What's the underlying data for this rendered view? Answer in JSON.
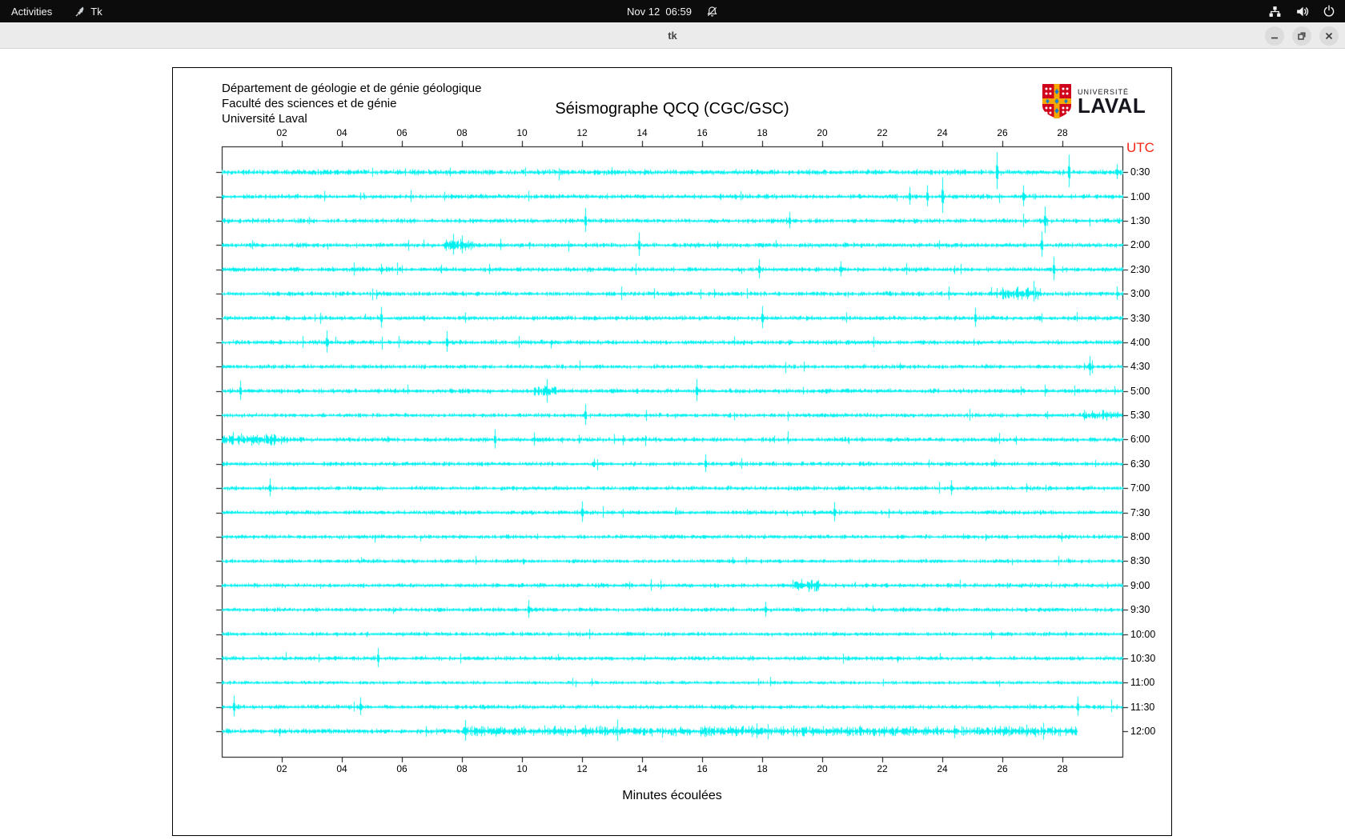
{
  "topbar": {
    "activities_label": "Activities",
    "app_name": "Tk",
    "clock": "Nov 12  06:59",
    "icons": [
      "tk-feather-icon",
      "notifications-disabled-icon",
      "network-wired-icon",
      "volume-icon",
      "power-icon"
    ]
  },
  "titlebar": {
    "title": "tk",
    "buttons": [
      "minimize",
      "maximize",
      "close"
    ]
  },
  "seismograph": {
    "header_lines": {
      "0": "Département de géologie et de génie géologique",
      "1": "Faculté des sciences et de génie",
      "2": "Université Laval"
    },
    "title": "Séismographe QCQ (CGC/GSC)",
    "logo": {
      "small_text": "UNIVERSITÉ",
      "large_text": "LAVAL"
    },
    "utc_label": "UTC",
    "xlabel": "Minutes écoulées",
    "colors": {
      "trace": "#00f0f0",
      "axis": "#000000",
      "utc_red": "#f52415"
    },
    "x_ticks": [
      {
        "minute": 2,
        "label": "02"
      },
      {
        "minute": 4,
        "label": "04"
      },
      {
        "minute": 6,
        "label": "06"
      },
      {
        "minute": 8,
        "label": "08"
      },
      {
        "minute": 10,
        "label": "10"
      },
      {
        "minute": 12,
        "label": "12"
      },
      {
        "minute": 14,
        "label": "14"
      },
      {
        "minute": 16,
        "label": "16"
      },
      {
        "minute": 18,
        "label": "18"
      },
      {
        "minute": 20,
        "label": "20"
      },
      {
        "minute": 22,
        "label": "22"
      },
      {
        "minute": 24,
        "label": "24"
      },
      {
        "minute": 26,
        "label": "26"
      },
      {
        "minute": 28,
        "label": "28"
      }
    ],
    "minutes_span": 30,
    "rows": [
      {
        "label": "0:30",
        "end": 30,
        "noise": 1.5,
        "spikes": [
          [
            3.2,
            4
          ],
          [
            5.0,
            3
          ],
          [
            6.1,
            5
          ],
          [
            7.6,
            6
          ],
          [
            10.1,
            6
          ],
          [
            25.8,
            25
          ],
          [
            28.2,
            22
          ],
          [
            29.8,
            10
          ]
        ],
        "bands": []
      },
      {
        "label": "1:00",
        "end": 30,
        "noise": 1.3,
        "spikes": [
          [
            3.4,
            7
          ],
          [
            4.6,
            5
          ],
          [
            6.3,
            8
          ],
          [
            7.4,
            6
          ],
          [
            10.2,
            7
          ],
          [
            22.9,
            12
          ],
          [
            23.5,
            14
          ],
          [
            24.0,
            24
          ],
          [
            26.7,
            14
          ]
        ],
        "bands": []
      },
      {
        "label": "1:30",
        "end": 30,
        "noise": 1.3,
        "spikes": [
          [
            2.9,
            5
          ],
          [
            12.1,
            16
          ],
          [
            18.9,
            11
          ],
          [
            26.7,
            9
          ],
          [
            27.4,
            18
          ]
        ],
        "bands": []
      },
      {
        "label": "2:00",
        "end": 30,
        "noise": 1.3,
        "spikes": [
          [
            1.0,
            6
          ],
          [
            7.7,
            14
          ],
          [
            8.0,
            12
          ],
          [
            13.9,
            16
          ],
          [
            23.9,
            6
          ],
          [
            27.3,
            17
          ]
        ],
        "bands": [
          [
            7.4,
            8.4,
            3
          ]
        ]
      },
      {
        "label": "2:30",
        "end": 30,
        "noise": 1.3,
        "spikes": [
          [
            4.4,
            9
          ],
          [
            5.3,
            7
          ],
          [
            6.0,
            5
          ],
          [
            7.3,
            6
          ],
          [
            8.9,
            7
          ],
          [
            17.9,
            13
          ],
          [
            20.6,
            10
          ],
          [
            22.8,
            8
          ],
          [
            24.6,
            7
          ],
          [
            27.7,
            16
          ]
        ],
        "bands": []
      },
      {
        "label": "3:00",
        "end": 30,
        "noise": 1.3,
        "spikes": [
          [
            13.3,
            9
          ],
          [
            14.4,
            7
          ],
          [
            16.4,
            6
          ],
          [
            17.5,
            7
          ],
          [
            24.2,
            9
          ],
          [
            26.0,
            8
          ],
          [
            26.5,
            9
          ],
          [
            27.1,
            8
          ],
          [
            29.8,
            9
          ]
        ],
        "bands": [
          [
            25.8,
            27.3,
            3
          ]
        ]
      },
      {
        "label": "3:30",
        "end": 30,
        "noise": 1.3,
        "spikes": [
          [
            3.1,
            5
          ],
          [
            5.3,
            14
          ],
          [
            8.1,
            7
          ],
          [
            18.0,
            15
          ],
          [
            20.8,
            7
          ],
          [
            25.1,
            13
          ],
          [
            27.3,
            6
          ]
        ],
        "bands": []
      },
      {
        "label": "4:00",
        "end": 30,
        "noise": 1.3,
        "spikes": [
          [
            2.7,
            8
          ],
          [
            3.5,
            15
          ],
          [
            5.9,
            8
          ],
          [
            7.5,
            14
          ],
          [
            9.9,
            8
          ],
          [
            21.7,
            7
          ]
        ],
        "bands": []
      },
      {
        "label": "4:30",
        "end": 30,
        "noise": 1.2,
        "spikes": [
          [
            28.9,
            13
          ]
        ],
        "bands": []
      },
      {
        "label": "5:00",
        "end": 30,
        "noise": 1.3,
        "spikes": [
          [
            0.6,
            13
          ],
          [
            10.8,
            6
          ],
          [
            15.8,
            15
          ],
          [
            26.6,
            6
          ],
          [
            27.4,
            8
          ],
          [
            28.4,
            7
          ]
        ],
        "bands": [
          [
            10.4,
            11.2,
            3
          ]
        ]
      },
      {
        "label": "5:30",
        "end": 30,
        "noise": 1.2,
        "spikes": [
          [
            12.1,
            14
          ],
          [
            24.9,
            8
          ]
        ],
        "bands": [
          [
            28.7,
            29.9,
            2.6
          ]
        ]
      },
      {
        "label": "6:00",
        "end": 30,
        "noise": 1.3,
        "spikes": [
          [
            9.1,
            13
          ],
          [
            10.4,
            9
          ],
          [
            11.9,
            6
          ],
          [
            18.4,
            5
          ]
        ],
        "bands": [
          [
            0,
            2.2,
            3
          ]
        ]
      },
      {
        "label": "6:30",
        "end": 30,
        "noise": 1.2,
        "spikes": [
          [
            16.1,
            12
          ],
          [
            17.3,
            7
          ],
          [
            29.1,
            5
          ]
        ],
        "bands": []
      },
      {
        "label": "7:00",
        "end": 30,
        "noise": 1.2,
        "spikes": [
          [
            1.6,
            12
          ],
          [
            23.9,
            8
          ],
          [
            24.3,
            10
          ],
          [
            26.8,
            6
          ]
        ],
        "bands": []
      },
      {
        "label": "7:30",
        "end": 30,
        "noise": 1.2,
        "spikes": [
          [
            12.0,
            14
          ],
          [
            12.7,
            8
          ],
          [
            20.4,
            13
          ]
        ],
        "bands": []
      },
      {
        "label": "8:00",
        "end": 30,
        "noise": 1.2,
        "spikes": [
          [
            10.5,
            4
          ]
        ],
        "bands": []
      },
      {
        "label": "8:30",
        "end": 30,
        "noise": 1.1,
        "spikes": [],
        "bands": []
      },
      {
        "label": "9:00",
        "end": 30,
        "noise": 1.2,
        "spikes": [
          [
            14.3,
            8
          ],
          [
            14.6,
            6
          ]
        ],
        "bands": [
          [
            19.0,
            19.9,
            4
          ]
        ]
      },
      {
        "label": "9:30",
        "end": 30,
        "noise": 1.2,
        "spikes": [
          [
            10.2,
            12
          ],
          [
            18.1,
            10
          ]
        ],
        "bands": []
      },
      {
        "label": "10:00",
        "end": 30,
        "noise": 1.1,
        "spikes": [],
        "bands": []
      },
      {
        "label": "10:30",
        "end": 30,
        "noise": 1.2,
        "spikes": [
          [
            5.2,
            13
          ]
        ],
        "bands": []
      },
      {
        "label": "11:00",
        "end": 30,
        "noise": 1.0,
        "spikes": [],
        "bands": []
      },
      {
        "label": "11:30",
        "end": 30,
        "noise": 1.2,
        "spikes": [
          [
            0.4,
            14
          ],
          [
            4.6,
            12
          ],
          [
            28.5,
            13
          ]
        ],
        "bands": []
      },
      {
        "label": "12:00",
        "end": 28.5,
        "noise": 1.4,
        "spikes": [
          [
            8.1,
            14
          ],
          [
            12.1,
            8
          ],
          [
            16.4,
            6
          ],
          [
            17.8,
            10
          ],
          [
            25.5,
            5
          ]
        ],
        "bands": [
          [
            8,
            28.5,
            2.7
          ]
        ]
      }
    ]
  }
}
